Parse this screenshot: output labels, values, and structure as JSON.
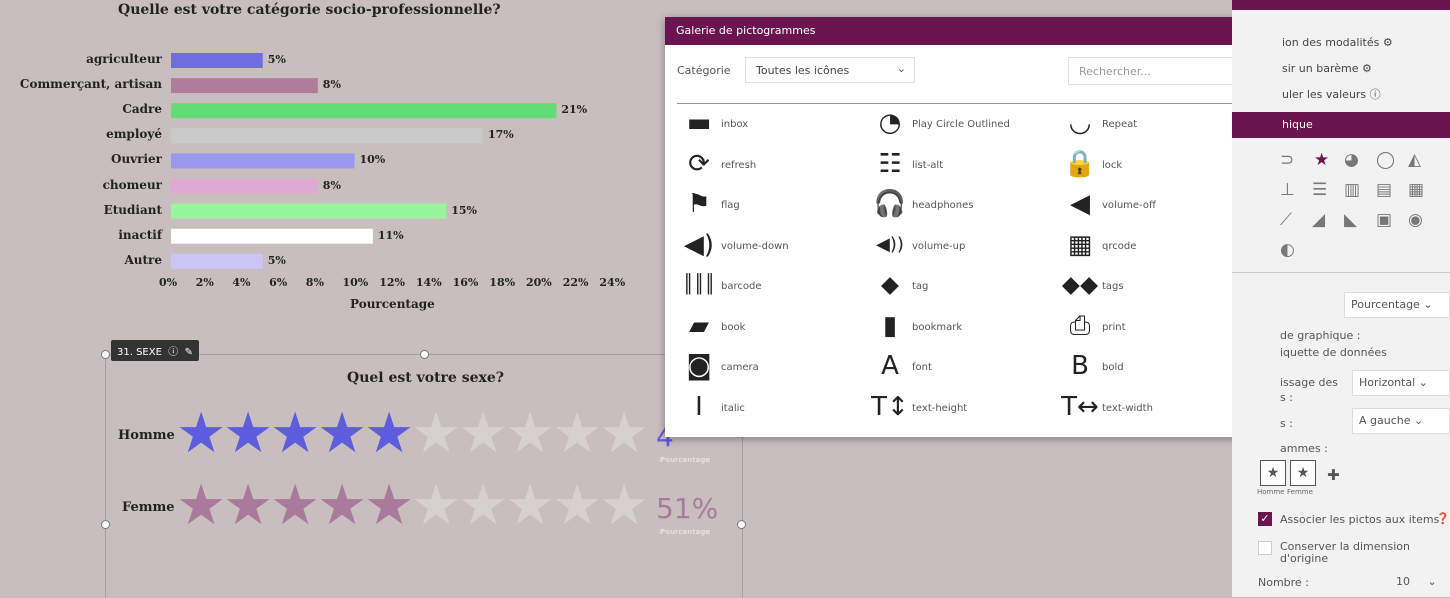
{
  "chart1": {
    "title": "Quelle est votre catégorie socio-professionnelle?",
    "xlabel": "Pourcentage",
    "ticks": [
      "0%",
      "2%",
      "4%",
      "6%",
      "8%",
      "10%",
      "12%",
      "14%",
      "16%",
      "18%",
      "20%",
      "22%",
      "24%"
    ]
  },
  "chart_data": {
    "type": "bar",
    "orientation": "horizontal",
    "title": "Quelle est votre catégorie socio-professionnelle?",
    "xlabel": "Pourcentage",
    "ylabel": "",
    "xlim": [
      0,
      24
    ],
    "categories": [
      "agriculteur",
      "Commerçant, artisan",
      "Cadre",
      "employé",
      "Ouvrier",
      "chomeur",
      "Etudiant",
      "inactif",
      "Autre"
    ],
    "values": [
      5,
      8,
      21,
      17,
      10,
      8,
      15,
      11,
      5
    ],
    "value_labels": [
      "5%",
      "8%",
      "21%",
      "17%",
      "10%",
      "8%",
      "15%",
      "11%",
      "5%"
    ],
    "colors": [
      "#6f6ee0",
      "#b07c9c",
      "#62dc74",
      "#c9c9c9",
      "#9a97ee",
      "#e0a9d4",
      "#97f59d",
      "#ffffff",
      "#cbc5f5"
    ]
  },
  "chart2": {
    "tag": "31. SEXE",
    "title": "Quel est votre sexe?",
    "rows": [
      {
        "label": "Homme",
        "filled": 5,
        "total": 10,
        "color": "#5d5ddd",
        "pct": "4",
        "pct_label": "Pourcentage"
      },
      {
        "label": "Femme",
        "filled": 5,
        "total": 10,
        "color": "#aa7a9c",
        "pct": "51%",
        "pct_label": "Pourcentage"
      }
    ]
  },
  "dialog": {
    "title": "Galerie de pictogrammes",
    "category_label": "Catégorie",
    "category_value": "Toutes les icônes",
    "search_placeholder": "Rechercher...",
    "icons": [
      {
        "name": "inbox",
        "glyph": "▬"
      },
      {
        "name": "Play Circle Outlined",
        "glyph": "◔"
      },
      {
        "name": "Repeat",
        "glyph": "◡"
      },
      {
        "name": "refresh",
        "glyph": "⟳"
      },
      {
        "name": "list-alt",
        "glyph": "☷"
      },
      {
        "name": "lock",
        "glyph": "🔒"
      },
      {
        "name": "flag",
        "glyph": "⚑"
      },
      {
        "name": "headphones",
        "glyph": "🎧"
      },
      {
        "name": "volume-off",
        "glyph": "◀"
      },
      {
        "name": "volume-down",
        "glyph": "◀)"
      },
      {
        "name": "volume-up",
        "glyph": "◀))"
      },
      {
        "name": "qrcode",
        "glyph": "▦"
      },
      {
        "name": "barcode",
        "glyph": "║║║"
      },
      {
        "name": "tag",
        "glyph": "⬥"
      },
      {
        "name": "tags",
        "glyph": "⬥⬥"
      },
      {
        "name": "book",
        "glyph": "▰"
      },
      {
        "name": "bookmark",
        "glyph": "▮"
      },
      {
        "name": "print",
        "glyph": "⎙"
      },
      {
        "name": "camera",
        "glyph": "◙"
      },
      {
        "name": "font",
        "glyph": "A"
      },
      {
        "name": "bold",
        "glyph": "B"
      },
      {
        "name": "italic",
        "glyph": "I"
      },
      {
        "name": "text-height",
        "glyph": "T↕"
      },
      {
        "name": "text-width",
        "glyph": "T↔"
      }
    ]
  },
  "panel": {
    "link1": "ion des modalités",
    "link2": "sir un barème",
    "link3": "uler les valeurs",
    "section_title": "hique",
    "select_mode": "Pourcentage",
    "chart_label_1": "de graphique :",
    "chart_label_2": "iquette de données",
    "disp_label": "issage des",
    "disp_label2": "s :",
    "disp_value": "Horizontal",
    "align_label": "s :",
    "align_value": "A gauche",
    "pictos_label": "ammes :",
    "picto_lab_1": "Homme",
    "picto_lab_2": "Femme",
    "assoc_label": "Associer les pictos aux items",
    "keep_label": "Conserver la dimension d'origine",
    "nombre_label": "Nombre :",
    "nombre_value": "10"
  },
  "colors": {
    "accent": "#6b1550",
    "canvas": "#c8bebe",
    "panel": "#f2f2f2"
  }
}
